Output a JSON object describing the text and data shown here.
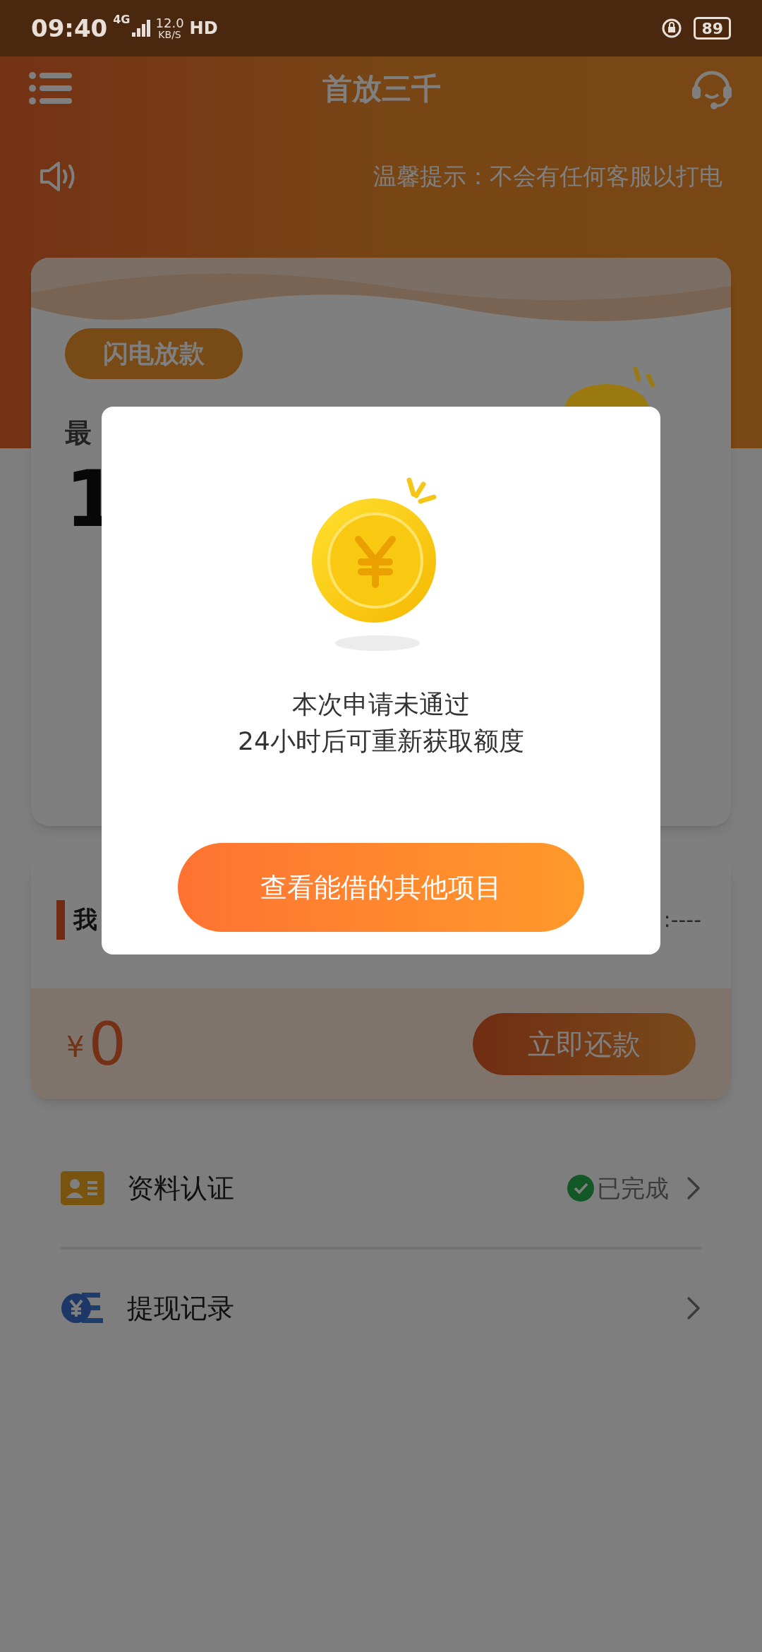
{
  "status_bar": {
    "time": "09:40",
    "network": "4G",
    "speed": "12.0",
    "speed_unit": "KB/S",
    "hd": "HD",
    "battery": "89"
  },
  "header": {
    "title": "首放三千"
  },
  "notice": {
    "text": "温馨提示：不会有任何客服以打电"
  },
  "loan_card": {
    "badge": "闪电放款",
    "label": "最",
    "amount": "1"
  },
  "repay_card": {
    "title": "我",
    "date": ":----",
    "currency": "¥",
    "amount": "0",
    "button": "立即还款"
  },
  "menu": [
    {
      "label": "资料认证",
      "status": "已完成",
      "kind": "status"
    },
    {
      "label": "提现记录",
      "kind": "plain"
    }
  ],
  "dialog": {
    "message_lines": [
      "本次申请未通过",
      "24小时后可重新获取额度"
    ],
    "button": "查看能借的其他项目"
  }
}
